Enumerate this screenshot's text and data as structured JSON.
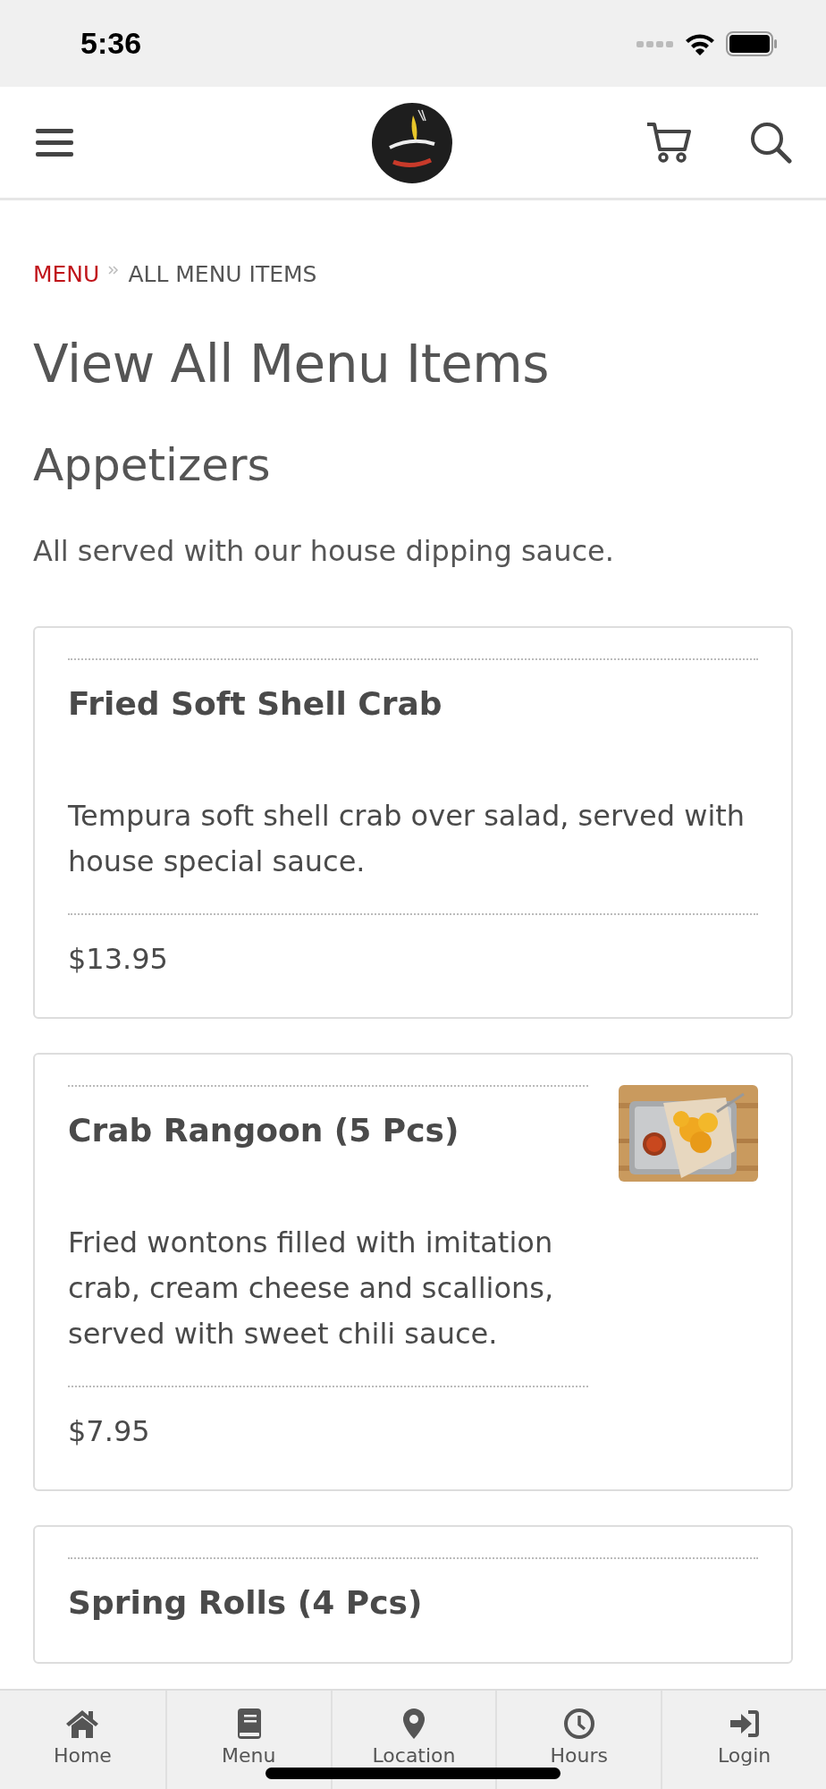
{
  "status_bar": {
    "time": "5:36"
  },
  "breadcrumb": [
    {
      "label": "MENU",
      "kind": "link"
    },
    {
      "label": "ALL MENU ITEMS",
      "kind": "current"
    }
  ],
  "title": "View All Menu Items",
  "section": {
    "title": "Appetizers",
    "description": "All served with our house dipping sauce."
  },
  "items": [
    {
      "name": "Fried Soft Shell Crab",
      "description": "Tempura soft shell crab over salad, served with house special sauce.",
      "price": "$13.95"
    },
    {
      "name": "Crab Rangoon (5 Pcs)",
      "description": "Fried wontons filled with imitation crab, cream cheese and scallions, served with sweet chili sauce.",
      "price": "$7.95"
    },
    {
      "name": "Spring Rolls (4 Pcs)"
    }
  ],
  "bottom_nav": [
    {
      "label": "Home",
      "kind": "home"
    },
    {
      "label": "Menu",
      "kind": "book"
    },
    {
      "label": "Location",
      "kind": "pin"
    },
    {
      "label": "Hours",
      "kind": "clock"
    },
    {
      "label": "Login",
      "kind": "login"
    }
  ]
}
